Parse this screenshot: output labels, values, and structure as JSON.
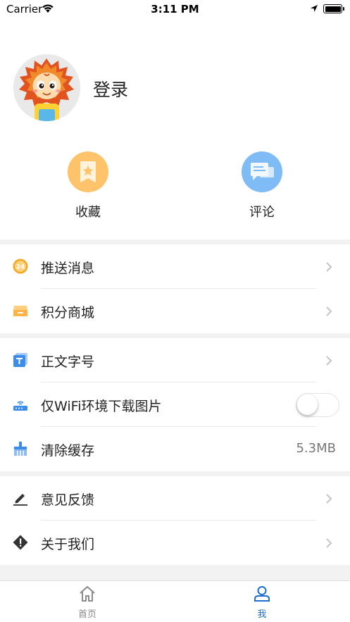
{
  "status_bar": {
    "carrier": "Carrier",
    "time": "3:11 PM"
  },
  "profile": {
    "login_label": "登录"
  },
  "quick_actions": [
    {
      "label": "收藏",
      "icon": "bookmark-star-icon",
      "color": "#ffc46b"
    },
    {
      "label": "评论",
      "icon": "chat-bubbles-icon",
      "color": "#7fbcf5"
    }
  ],
  "menu": {
    "group1": [
      {
        "label": "推送消息",
        "icon": "push-24-icon"
      },
      {
        "label": "积分商城",
        "icon": "store-icon"
      }
    ],
    "group2": [
      {
        "label": "正文字号",
        "icon": "text-size-icon"
      },
      {
        "label": "仅WiFi环境下载图片",
        "icon": "router-icon",
        "toggle_on": false
      },
      {
        "label": "清除缓存",
        "icon": "broom-icon",
        "value": "5.3MB"
      }
    ],
    "group3": [
      {
        "label": "意见反馈",
        "icon": "pencil-icon"
      },
      {
        "label": "关于我们",
        "icon": "info-diamond-icon"
      }
    ]
  },
  "tabbar": {
    "items": [
      {
        "label": "首页",
        "icon": "home-icon",
        "active": false
      },
      {
        "label": "我",
        "icon": "user-icon",
        "active": true
      }
    ],
    "active_color": "#1e6fd1",
    "inactive_color": "#8a8a8a"
  }
}
